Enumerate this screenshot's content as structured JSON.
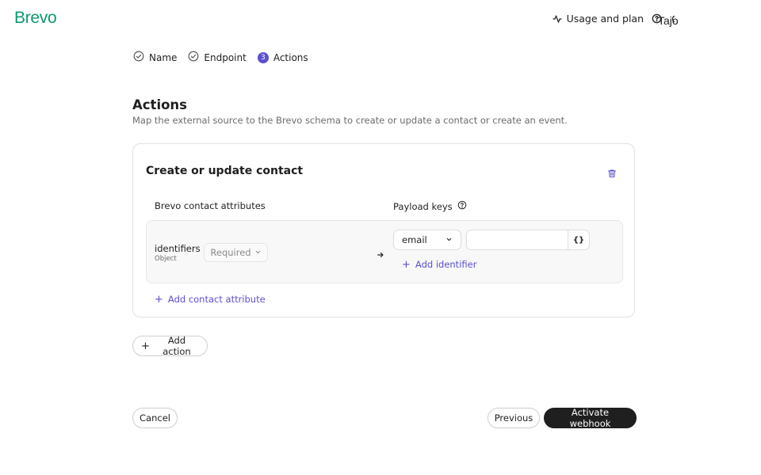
{
  "header": {
    "logo_text": "Brevo",
    "usage_label": "Usage and plan",
    "user_name": "Tajo"
  },
  "stepper": {
    "steps": [
      {
        "label": "Name",
        "state": "done"
      },
      {
        "label": "Endpoint",
        "state": "done"
      },
      {
        "label": "Actions",
        "state": "current",
        "number": "3"
      }
    ]
  },
  "page": {
    "title": "Actions",
    "description": "Map the external source to the Brevo schema to create or update a contact or create an event."
  },
  "action_card": {
    "title": "Create or update contact",
    "left_column_label": "Brevo contact attributes",
    "right_column_label": "Payload keys",
    "mapping": {
      "attribute_name": "identifiers",
      "attribute_type": "Object",
      "required_select_value": "Required",
      "payload_key_select_value": "email",
      "payload_key_input_value": "",
      "braces_label": "{}",
      "add_identifier_label": "Add identifier"
    },
    "add_attribute_label": "Add contact attribute"
  },
  "buttons": {
    "add_action": "Add action",
    "cancel": "Cancel",
    "previous": "Previous",
    "activate": "Activate webhook"
  },
  "colors": {
    "brand_green": "#0b996e",
    "accent_purple": "#5b4fcf",
    "primary_button": "#1f1f1f"
  },
  "icons": [
    "activity-icon",
    "help-circle-icon",
    "check-circle-icon",
    "trash-icon",
    "arrow-right-icon",
    "chevron-down-icon",
    "plus-icon"
  ]
}
